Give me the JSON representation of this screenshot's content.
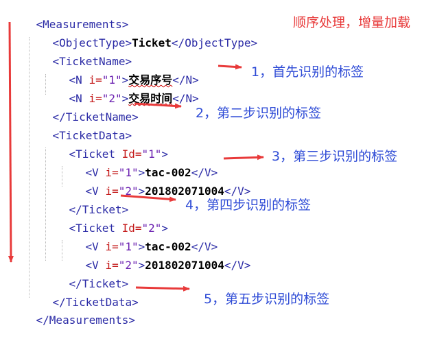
{
  "code": {
    "measurements_open": "<Measurements>",
    "objecttype_open": "<ObjectType>",
    "objecttype_value": "Ticket",
    "objecttype_close": "</ObjectType>",
    "ticketname_open": "<TicketName>",
    "n1_open_a": "<N ",
    "n1_attr": "i=",
    "n1_val": "\"1\"",
    "n1_open_b": ">",
    "n1_text": "交易序号",
    "n1_close": "</N>",
    "n2_open_a": "<N ",
    "n2_attr": "i=",
    "n2_val": "\"2\"",
    "n2_open_b": ">",
    "n2_text": "交易时间",
    "n2_close": "</N>",
    "ticketname_close": "</TicketName>",
    "ticketdata_open": "<TicketData>",
    "ticket1_open_a": "<Ticket ",
    "ticket1_attr": "Id=",
    "ticket1_val": "\"1\"",
    "ticket1_open_b": ">",
    "t1v1_open_a": "<V ",
    "t1v1_attr": "i=",
    "t1v1_val": "\"1\"",
    "t1v1_open_b": ">",
    "t1v1_text": "tac-002",
    "t1v1_close": "</V>",
    "t1v2_open_a": "<V ",
    "t1v2_attr": "i=",
    "t1v2_val": "\"2\"",
    "t1v2_open_b": ">",
    "t1v2_text": "201802071004",
    "t1v2_close": "</V>",
    "ticket1_close": "</Ticket>",
    "ticket2_open_a": "<Ticket ",
    "ticket2_attr": "Id=",
    "ticket2_val": "\"2\"",
    "ticket2_open_b": ">",
    "t2v1_open_a": "<V ",
    "t2v1_attr": "i=",
    "t2v1_val": "\"1\"",
    "t2v1_open_b": ">",
    "t2v1_text": "tac-002",
    "t2v1_close": "</V>",
    "t2v2_open_a": "<V ",
    "t2v2_attr": "i=",
    "t2v2_val": "\"2\"",
    "t2v2_open_b": ">",
    "t2v2_text": "201802071004",
    "t2v2_close": "</V>",
    "ticket2_close": "</Ticket>",
    "ticketdata_close": "</TicketData>",
    "measurements_close": "</Measurements>"
  },
  "annotations": {
    "header": "顺序处理，增量加载",
    "step1": "1，首先识别的标签",
    "step2": "2，第二步识别的标签",
    "step3": "3，第三步识别的标签",
    "step4": "4，第四步识别的标签",
    "step5": "5，第五步识别的标签"
  },
  "colors": {
    "tag": "#2b2ba6",
    "attribute": "#c41a1a",
    "attribute_value": "#6a1fb0",
    "annotation": "#2e4bd6",
    "arrow": "#e83a3a"
  }
}
